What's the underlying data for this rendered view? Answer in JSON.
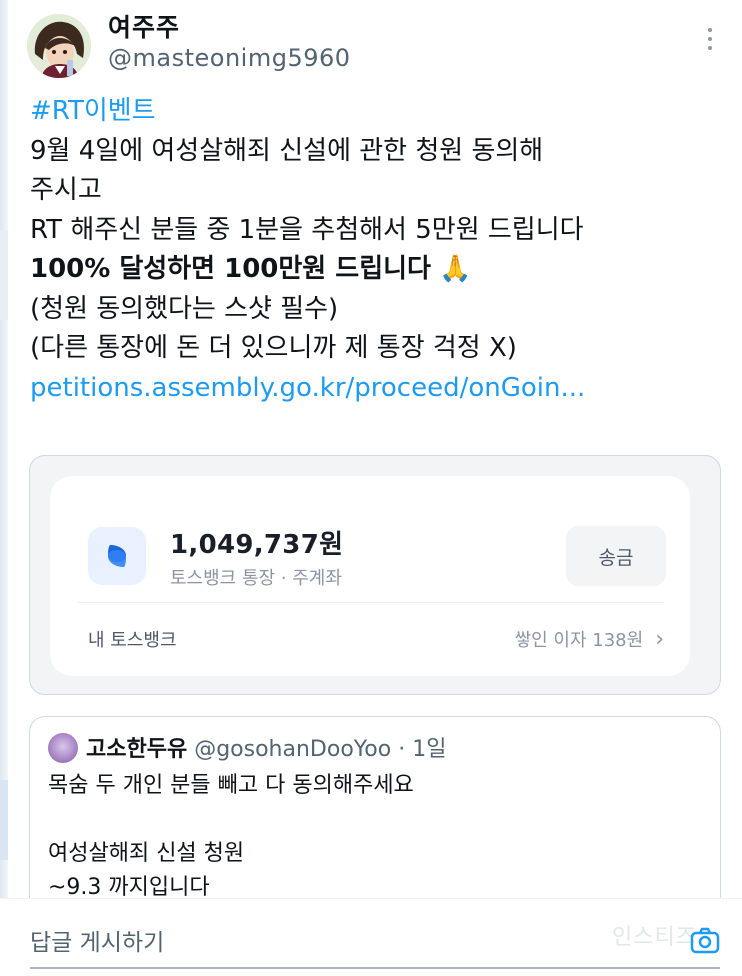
{
  "tweet": {
    "display_name": "여주주",
    "handle": "@masteonimg5960",
    "hashtag": "#RT이벤트",
    "lines": [
      "9월 4일에 여성살해죄 신설에 관한 청원 동의해",
      "주시고",
      "RT 해주신 분들 중 1분을 추첨해서 5만원 드립니다"
    ],
    "bold_line": "100% 달성하면 100만원 드립니다",
    "emoji": "🙏",
    "lines_after": [
      "(청원 동의했다는 스샷 필수)",
      "(다른 통장에 돈 더 있으니까 제 통장 걱정 X)"
    ],
    "link": "petitions.assembly.go.kr/proceed/onGoin..."
  },
  "bank_card": {
    "amount": "1,049,737원",
    "account_name": "토스뱅크 통장 · 주계좌",
    "send_label": "송금",
    "footer_label": "내 토스뱅크",
    "interest_text": "쌓인 이자 138원",
    "brand_color": "#3182f6"
  },
  "quote": {
    "name": "고소한두유",
    "handle_time": "@gosohanDooYoo · 1일",
    "lines": [
      "목숨 두 개인 분들 빼고 다 동의해주세요",
      "",
      "여성살해죄 신설 청원",
      "~9.3 까지입니다"
    ]
  },
  "reply": {
    "placeholder": "답글 게시하기",
    "watermark": "인스티즈"
  },
  "colors": {
    "accent": "#1d9bf0",
    "text": "#0f1419",
    "secondary": "#536471"
  }
}
